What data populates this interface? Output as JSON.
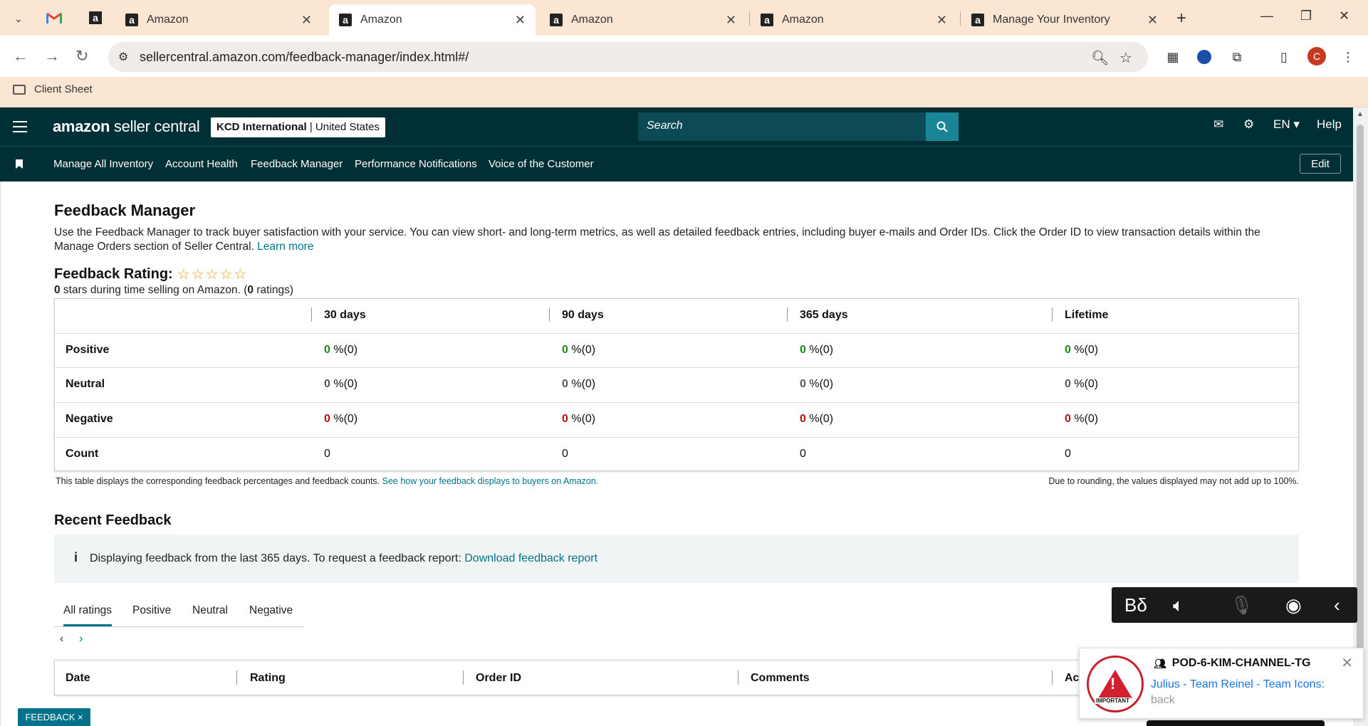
{
  "browser": {
    "tabs": [
      {
        "title": "Amazon"
      },
      {
        "title": "Amazon"
      },
      {
        "title": "Amazon"
      },
      {
        "title": "Amazon"
      },
      {
        "title": "Manage Your Inventory"
      }
    ],
    "url": "sellercentral.amazon.com/feedback-manager/index.html#/",
    "bookmark": "Client Sheet",
    "profile_initial": "C"
  },
  "header": {
    "logo_main": "amazon",
    "logo_rest": " seller central",
    "account_name": "KCD International",
    "account_region": " | United States",
    "search_placeholder": "Search",
    "language": "EN ▾",
    "help": "Help"
  },
  "nav": {
    "items": [
      "Manage All Inventory",
      "Account Health",
      "Feedback Manager",
      "Performance Notifications",
      "Voice of the Customer"
    ],
    "edit": "Edit"
  },
  "page": {
    "title": "Feedback Manager",
    "description": "Use the Feedback Manager to track buyer satisfaction with your service. You can view short- and long-term metrics, as well as detailed feedback entries, including buyer e-mails and Order IDs. Click the Order ID to view transaction details within the Manage Orders section of Seller Central. ",
    "learn_more": "Learn more",
    "rating_label": "Feedback Rating:",
    "rating_stars": 0,
    "rating_sub_count": "0",
    "rating_sub_mid": " stars during time selling on Amazon. (",
    "rating_sub_ratings": "0",
    "rating_sub_end": " ratings)"
  },
  "feedback_table": {
    "columns": [
      "30 days",
      "90 days",
      "365 days",
      "Lifetime"
    ],
    "rows": [
      {
        "label": "Positive",
        "values": [
          "0",
          "0",
          "0",
          "0"
        ],
        "suffix": " %(0)"
      },
      {
        "label": "Neutral",
        "values": [
          "0",
          "0",
          "0",
          "0"
        ],
        "suffix": " %(0)"
      },
      {
        "label": "Negative",
        "values": [
          "0",
          "0",
          "0",
          "0"
        ],
        "suffix": " %(0)"
      },
      {
        "label": "Count",
        "values": [
          "0",
          "0",
          "0",
          "0"
        ]
      }
    ],
    "note_left": "This table displays the corresponding feedback percentages and feedback counts. ",
    "note_link": "See how your feedback displays to buyers on Amazon.",
    "note_right": "Due to rounding, the values displayed may not add up to 100%."
  },
  "recent": {
    "title": "Recent Feedback",
    "info_text": "Displaying feedback from the last 365 days. To request a feedback report: ",
    "info_link": "Download feedback report",
    "tabs": [
      "All ratings",
      "Positive",
      "Neutral",
      "Negative"
    ],
    "columns": [
      "Date",
      "Rating",
      "Order ID",
      "Comments",
      "Ac"
    ]
  },
  "notification": {
    "channel": "POD-6-KIM-CHANNEL-TG",
    "message_blue": "Julius - Team Reinel - Team Icons:",
    "message_grey": "back",
    "image_label": "IMPORTANT"
  },
  "feedback_pill": "FEEDBACK ×",
  "colors": {
    "header_bg": "#002f36",
    "accent": "#00738a",
    "positive": "#1b8a1b",
    "negative": "#b01212",
    "star": "#e3a21a"
  }
}
